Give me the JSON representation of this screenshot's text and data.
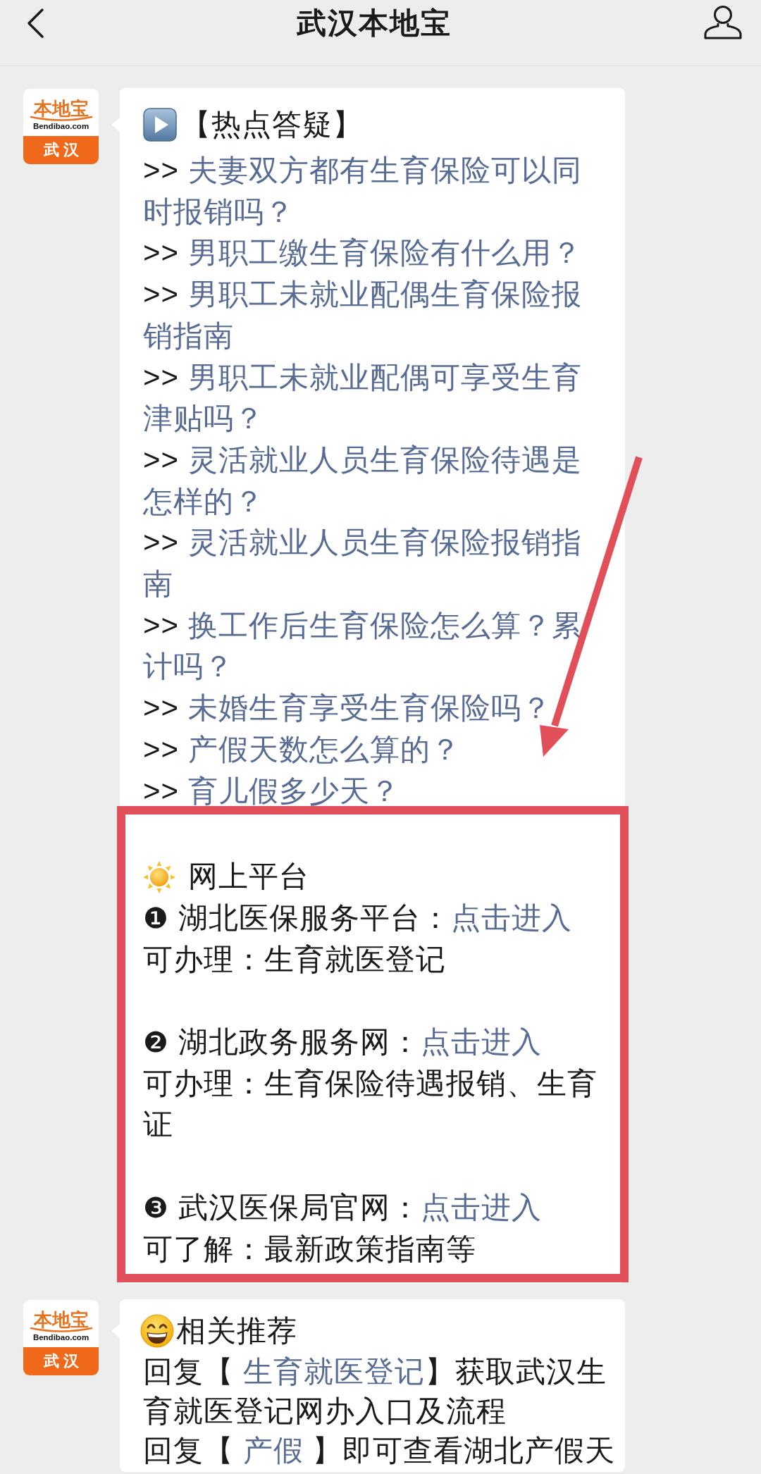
{
  "header": {
    "title": "武汉本地宝"
  },
  "messages": [
    {
      "kind": "faq",
      "avatar": {
        "brand": "本地宝",
        "domain": "Bendibao.com",
        "city": "武汉"
      },
      "heading": "【热点答疑】",
      "questions": [
        {
          "marker": ">>",
          "text": "夫妻双方都有生育保险可以同时报销吗？"
        },
        {
          "marker": ">>",
          "text": "男职工缴生育保险有什么用？"
        },
        {
          "marker": ">>",
          "text": "男职工未就业配偶生育保险报销指南"
        },
        {
          "marker": ">>",
          "text": "男职工未就业配偶可享受生育津贴吗？"
        },
        {
          "marker": ">>",
          "text": "灵活就业人员生育保险待遇是怎样的？"
        },
        {
          "marker": ">>",
          "text": "灵活就业人员生育保险报销指南"
        },
        {
          "marker": ">>",
          "text": "换工作后生育保险怎么算？累计吗？"
        },
        {
          "marker": ">>",
          "text": "未婚生育享受生育保险吗？"
        },
        {
          "marker": ">>",
          "text": "产假天数怎么算的？"
        },
        {
          "marker": ">>",
          "text": "育儿假多少天？"
        }
      ],
      "platforms": {
        "title": "网上平台",
        "items": [
          {
            "number": "❶",
            "name": "湖北医保服务平台：",
            "link": "点击进入",
            "note": "可办理：生育就医登记"
          },
          {
            "number": "❷",
            "name": "湖北政务服务网：",
            "link": "点击进入",
            "note": "可办理：生育保险待遇报销、生育证"
          },
          {
            "number": "❸",
            "name": "武汉医保局官网：",
            "link": "点击进入",
            "note": "可了解：最新政策指南等"
          }
        ]
      }
    },
    {
      "kind": "recommend",
      "avatar": {
        "brand": "本地宝",
        "domain": "Bendibao.com",
        "city": "武汉"
      },
      "heading": "相关推荐",
      "replies": [
        {
          "before": "回复【 ",
          "link": "生育就医登记",
          "after": "】获取武汉生育就医登记网办入口及流程"
        },
        {
          "before": "回复【 ",
          "link": "产假",
          "after": " 】即可查看湖北产假天"
        }
      ]
    }
  ]
}
